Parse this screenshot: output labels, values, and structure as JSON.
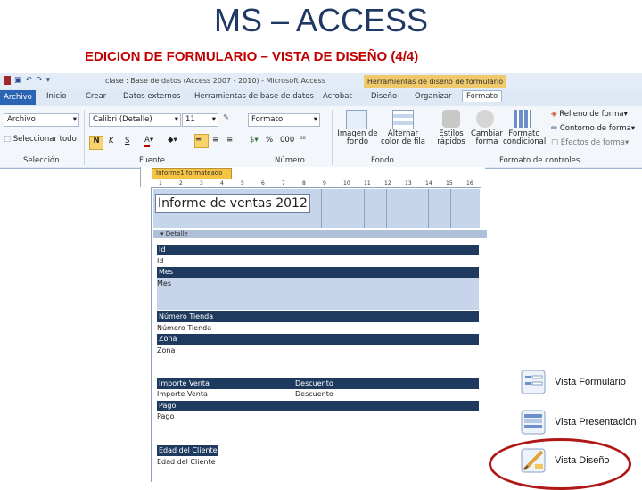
{
  "slide": {
    "title": "MS – ACCESS",
    "subtitle": "EDICION DE FORMULARIO – VISTA DE DISEÑO (4/4)"
  },
  "window": {
    "title": "clase : Base de datos (Access 2007 - 2010) - Microsoft Access",
    "contextual_header": "Herramientas de diseño de formulario"
  },
  "tabs": [
    "Archivo",
    "Inicio",
    "Crear",
    "Datos externos",
    "Herramientas de base de datos",
    "Acrobat",
    "Diseño",
    "Organizar",
    "Formato"
  ],
  "ribbon": {
    "select_value": "Archivo",
    "select_all": "Seleccionar todo",
    "group_seleccion": "Selección",
    "font_name": "Calibri (Detalle)",
    "font_size": "11",
    "bold": "N",
    "italic": "K",
    "underline": "S",
    "group_fuente": "Fuente",
    "number_format": "Formato",
    "percent": "%",
    "thousands": "000",
    "group_numero": "Número",
    "bg_image": "Imagen de fondo",
    "alt_row_color": "Alternar color de fila",
    "group_fondo": "Fondo",
    "quick_styles": "Estilos rápidos",
    "change_shape": "Cambiar forma",
    "conditional_format": "Formato condicional",
    "fill_shape": "Relleno de forma",
    "outline_shape": "Contorno de forma",
    "shape_effects": "Efectos de forma",
    "group_formato_controles": "Formato de controles"
  },
  "design": {
    "doc_tab": "Informe1 formateado",
    "ruler_numbers": [
      "1",
      "2",
      "3",
      "4",
      "5",
      "6",
      "7",
      "8",
      "9",
      "10",
      "11",
      "12",
      "13",
      "14",
      "15",
      "16"
    ],
    "report_title": "Informe de ventas 2012",
    "detail_section": "Detalle",
    "fields": {
      "id_label": "Id",
      "id_value": "Id",
      "mes_label": "Mes",
      "mes_value": "Mes",
      "tienda_label": "Número Tienda",
      "tienda_value": "Número Tienda",
      "zona_label": "Zona",
      "zona_value": "Zona",
      "importe_label": "Importe Venta",
      "descuento_label": "Descuento",
      "importe_value": "Importe Venta",
      "descuento_value": "Descuento",
      "pago_label": "Pago",
      "pago_value": "Pago",
      "edad_label": "Edad del Cliente",
      "edad_value": "Edad del Cliente"
    }
  },
  "views": {
    "form_view": "Vista Formulario",
    "layout_view": "Vista Presentación",
    "design_view": "Vista Diseño",
    "highlight_color": "#b01818"
  }
}
